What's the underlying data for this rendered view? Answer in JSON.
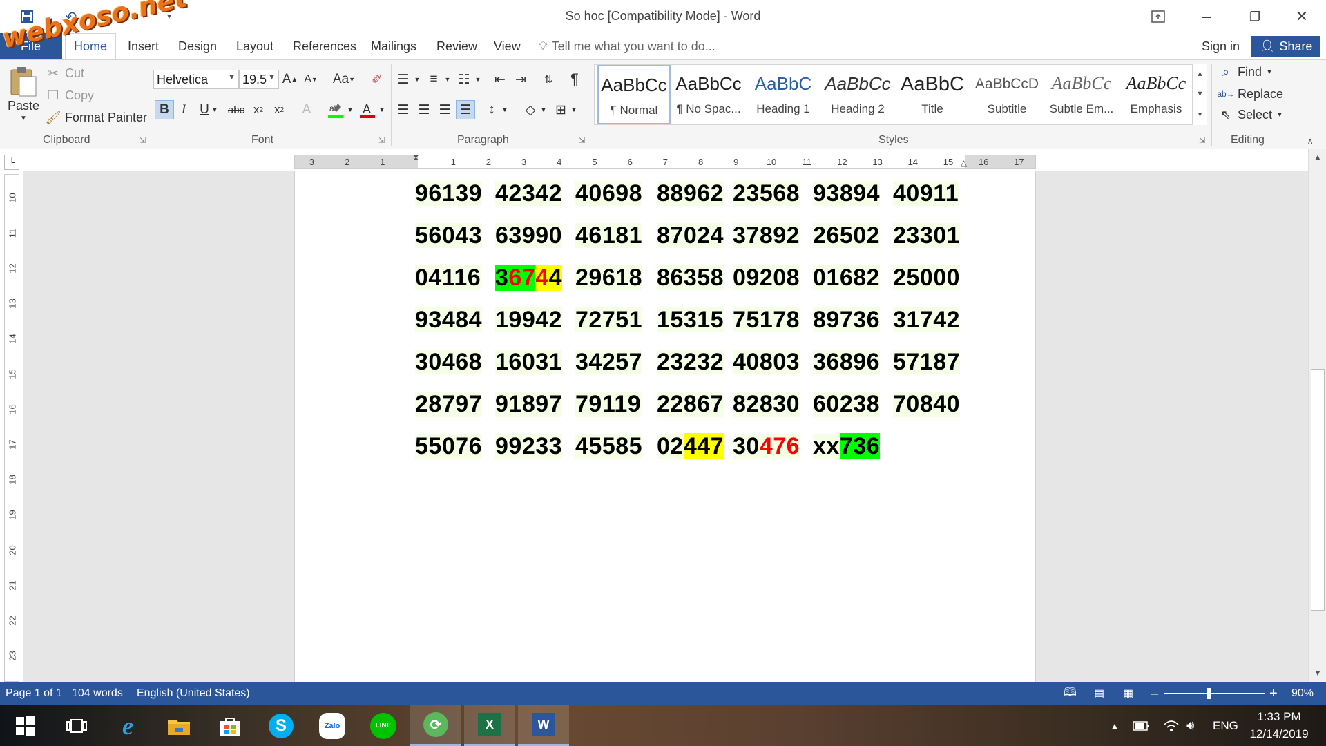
{
  "window": {
    "title": "So hoc [Compatibility Mode] - Word",
    "watermark": "webxoso.net"
  },
  "tabs": {
    "file": "File",
    "items": [
      "Home",
      "Insert",
      "Design",
      "Layout",
      "References",
      "Mailings",
      "Review",
      "View"
    ],
    "active": "Home",
    "tell_me": "Tell me what you want to do...",
    "sign_in": "Sign in",
    "share": "Share"
  },
  "clipboard": {
    "paste": "Paste",
    "cut": "Cut",
    "copy": "Copy",
    "format_painter": "Format Painter",
    "label": "Clipboard"
  },
  "font": {
    "name": "Helvetica",
    "size": "19.5",
    "label": "Font",
    "case_button": "Aa"
  },
  "paragraph": {
    "label": "Paragraph"
  },
  "styles": {
    "label": "Styles",
    "items": [
      {
        "preview": "AaBbCc",
        "name": "¶ Normal",
        "selected": true
      },
      {
        "preview": "AaBbCc",
        "name": "¶ No Spac..."
      },
      {
        "preview": "AaBbC",
        "name": "Heading 1"
      },
      {
        "preview": "AaBbCc",
        "name": "Heading 2"
      },
      {
        "preview": "AaBbC",
        "name": "Title"
      },
      {
        "preview": "AaBbCcD",
        "name": "Subtitle"
      },
      {
        "preview": "AaBbCc",
        "name": "Subtle Em..."
      },
      {
        "preview": "AaBbCc",
        "name": "Emphasis"
      }
    ]
  },
  "editing": {
    "find": "Find",
    "replace": "Replace",
    "select": "Select",
    "label": "Editing"
  },
  "ruler": {
    "horizontal": [
      "3",
      "2",
      "1",
      "1",
      "2",
      "3",
      "4",
      "5",
      "6",
      "7",
      "8",
      "9",
      "10",
      "11",
      "12",
      "13",
      "14",
      "15",
      "16",
      "17"
    ],
    "vertical": [
      "10",
      "11",
      "12",
      "13",
      "14",
      "15",
      "16",
      "17",
      "18",
      "19",
      "20",
      "21",
      "22",
      "23"
    ]
  },
  "document": {
    "rows": [
      [
        [
          {
            "t": "96139"
          }
        ],
        [
          {
            "t": "42342"
          }
        ],
        [
          {
            "t": "40698"
          }
        ],
        [
          {
            "t": "88962"
          }
        ],
        [
          {
            "t": "23568"
          }
        ],
        [
          {
            "t": "93894"
          }
        ],
        [
          {
            "t": "40911"
          }
        ]
      ],
      [
        [
          {
            "t": "56043"
          }
        ],
        [
          {
            "t": "63990"
          }
        ],
        [
          {
            "t": "46181"
          }
        ],
        [
          {
            "t": "87024"
          }
        ],
        [
          {
            "t": "37892"
          }
        ],
        [
          {
            "t": "26502"
          }
        ],
        [
          {
            "t": "23301"
          }
        ]
      ],
      [
        [
          {
            "t": "04116"
          }
        ],
        [
          {
            "t": "3",
            "hl": "green"
          },
          {
            "t": "67",
            "hl": "green",
            "color": "red"
          },
          {
            "t": "4",
            "hl": "yellow",
            "color": "red"
          },
          {
            "t": "4",
            "hl": "yellow"
          }
        ],
        [
          {
            "t": "29618"
          }
        ],
        [
          {
            "t": "86358"
          }
        ],
        [
          {
            "t": "09208"
          }
        ],
        [
          {
            "t": "01682"
          }
        ],
        [
          {
            "t": "25000"
          }
        ]
      ],
      [
        [
          {
            "t": "93484"
          }
        ],
        [
          {
            "t": "19942"
          }
        ],
        [
          {
            "t": "72751"
          }
        ],
        [
          {
            "t": "15315"
          }
        ],
        [
          {
            "t": "75178"
          }
        ],
        [
          {
            "t": "89736"
          }
        ],
        [
          {
            "t": "31742"
          }
        ]
      ],
      [
        [
          {
            "t": "30468"
          }
        ],
        [
          {
            "t": "16031"
          }
        ],
        [
          {
            "t": "34257"
          }
        ],
        [
          {
            "t": "23232"
          }
        ],
        [
          {
            "t": "40803"
          }
        ],
        [
          {
            "t": "36896"
          }
        ],
        [
          {
            "t": "57187"
          }
        ]
      ],
      [
        [
          {
            "t": "28797"
          }
        ],
        [
          {
            "t": "91897"
          }
        ],
        [
          {
            "t": "79119"
          }
        ],
        [
          {
            "t": "22867"
          }
        ],
        [
          {
            "t": "82830"
          }
        ],
        [
          {
            "t": "60238"
          }
        ],
        [
          {
            "t": "70840"
          }
        ]
      ],
      [
        [
          {
            "t": "55076"
          }
        ],
        [
          {
            "t": "99233"
          }
        ],
        [
          {
            "t": "45585"
          }
        ],
        [
          {
            "t": "02"
          },
          {
            "t": "447",
            "hl": "yellow"
          }
        ],
        [
          {
            "t": "30"
          },
          {
            "t": "476",
            "color": "red"
          }
        ],
        [
          {
            "t": "xx"
          },
          {
            "t": "736",
            "hl": "green"
          }
        ]
      ]
    ]
  },
  "status": {
    "page": "Page 1 of 1",
    "words": "104 words",
    "language": "English (United States)",
    "zoom": "90%",
    "zoom_percent": 90
  },
  "taskbar": {
    "language": "ENG",
    "time": "1:33 PM",
    "date": "12/14/2019",
    "apps": [
      "start",
      "task-view",
      "internet-explorer",
      "file-explorer",
      "store",
      "skype",
      "zalo",
      "line",
      "app-green",
      "excel",
      "word"
    ]
  },
  "colors": {
    "word_blue": "#2b579a",
    "highlight_green": "#00ff00",
    "highlight_yellow": "#ffff00",
    "text_red": "#ff0000"
  }
}
